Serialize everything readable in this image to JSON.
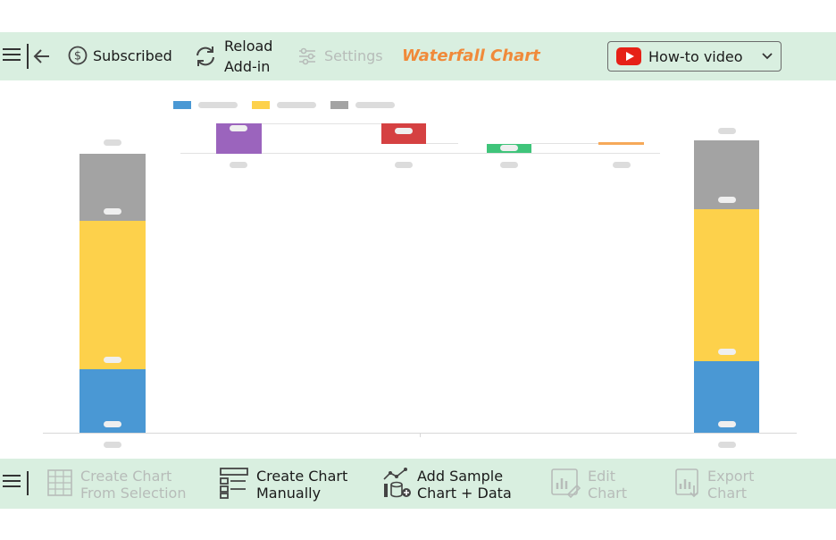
{
  "top_toolbar": {
    "subscribed_label": "Subscribed",
    "reload_line1": "Reload",
    "reload_line2": "Add-in",
    "settings_label": "Settings",
    "title": "Waterfall Chart",
    "video_label": "How-to video"
  },
  "bottom_toolbar": {
    "create_from_selection_line1": "Create Chart",
    "create_from_selection_line2": "From Selection",
    "create_manually_line1": "Create Chart",
    "create_manually_line2": "Manually",
    "add_sample_line1": "Add Sample",
    "add_sample_line2": "Chart + Data",
    "edit_line1": "Edit",
    "edit_line2": "Chart",
    "export_line1": "Export",
    "export_line2": "Chart"
  },
  "colors": {
    "toolbar_bg": "#d9efe0",
    "title": "#f08a3a",
    "blue": "#4a98d4",
    "yellow": "#fdd14b",
    "gray": "#a3a3a3",
    "purple": "#9b64bd",
    "red": "#d54142",
    "green": "#3fc47a",
    "orange": "#f6a959",
    "youtube": "#e62117"
  },
  "icons": [
    "menu-icon",
    "back-arrow-icon",
    "dollar-circle-icon",
    "refresh-icon",
    "sliders-icon",
    "youtube-icon",
    "chevron-down-icon",
    "spreadsheet-icon",
    "form-icon",
    "chart-database-icon",
    "edit-chart-icon",
    "export-chart-icon"
  ]
}
